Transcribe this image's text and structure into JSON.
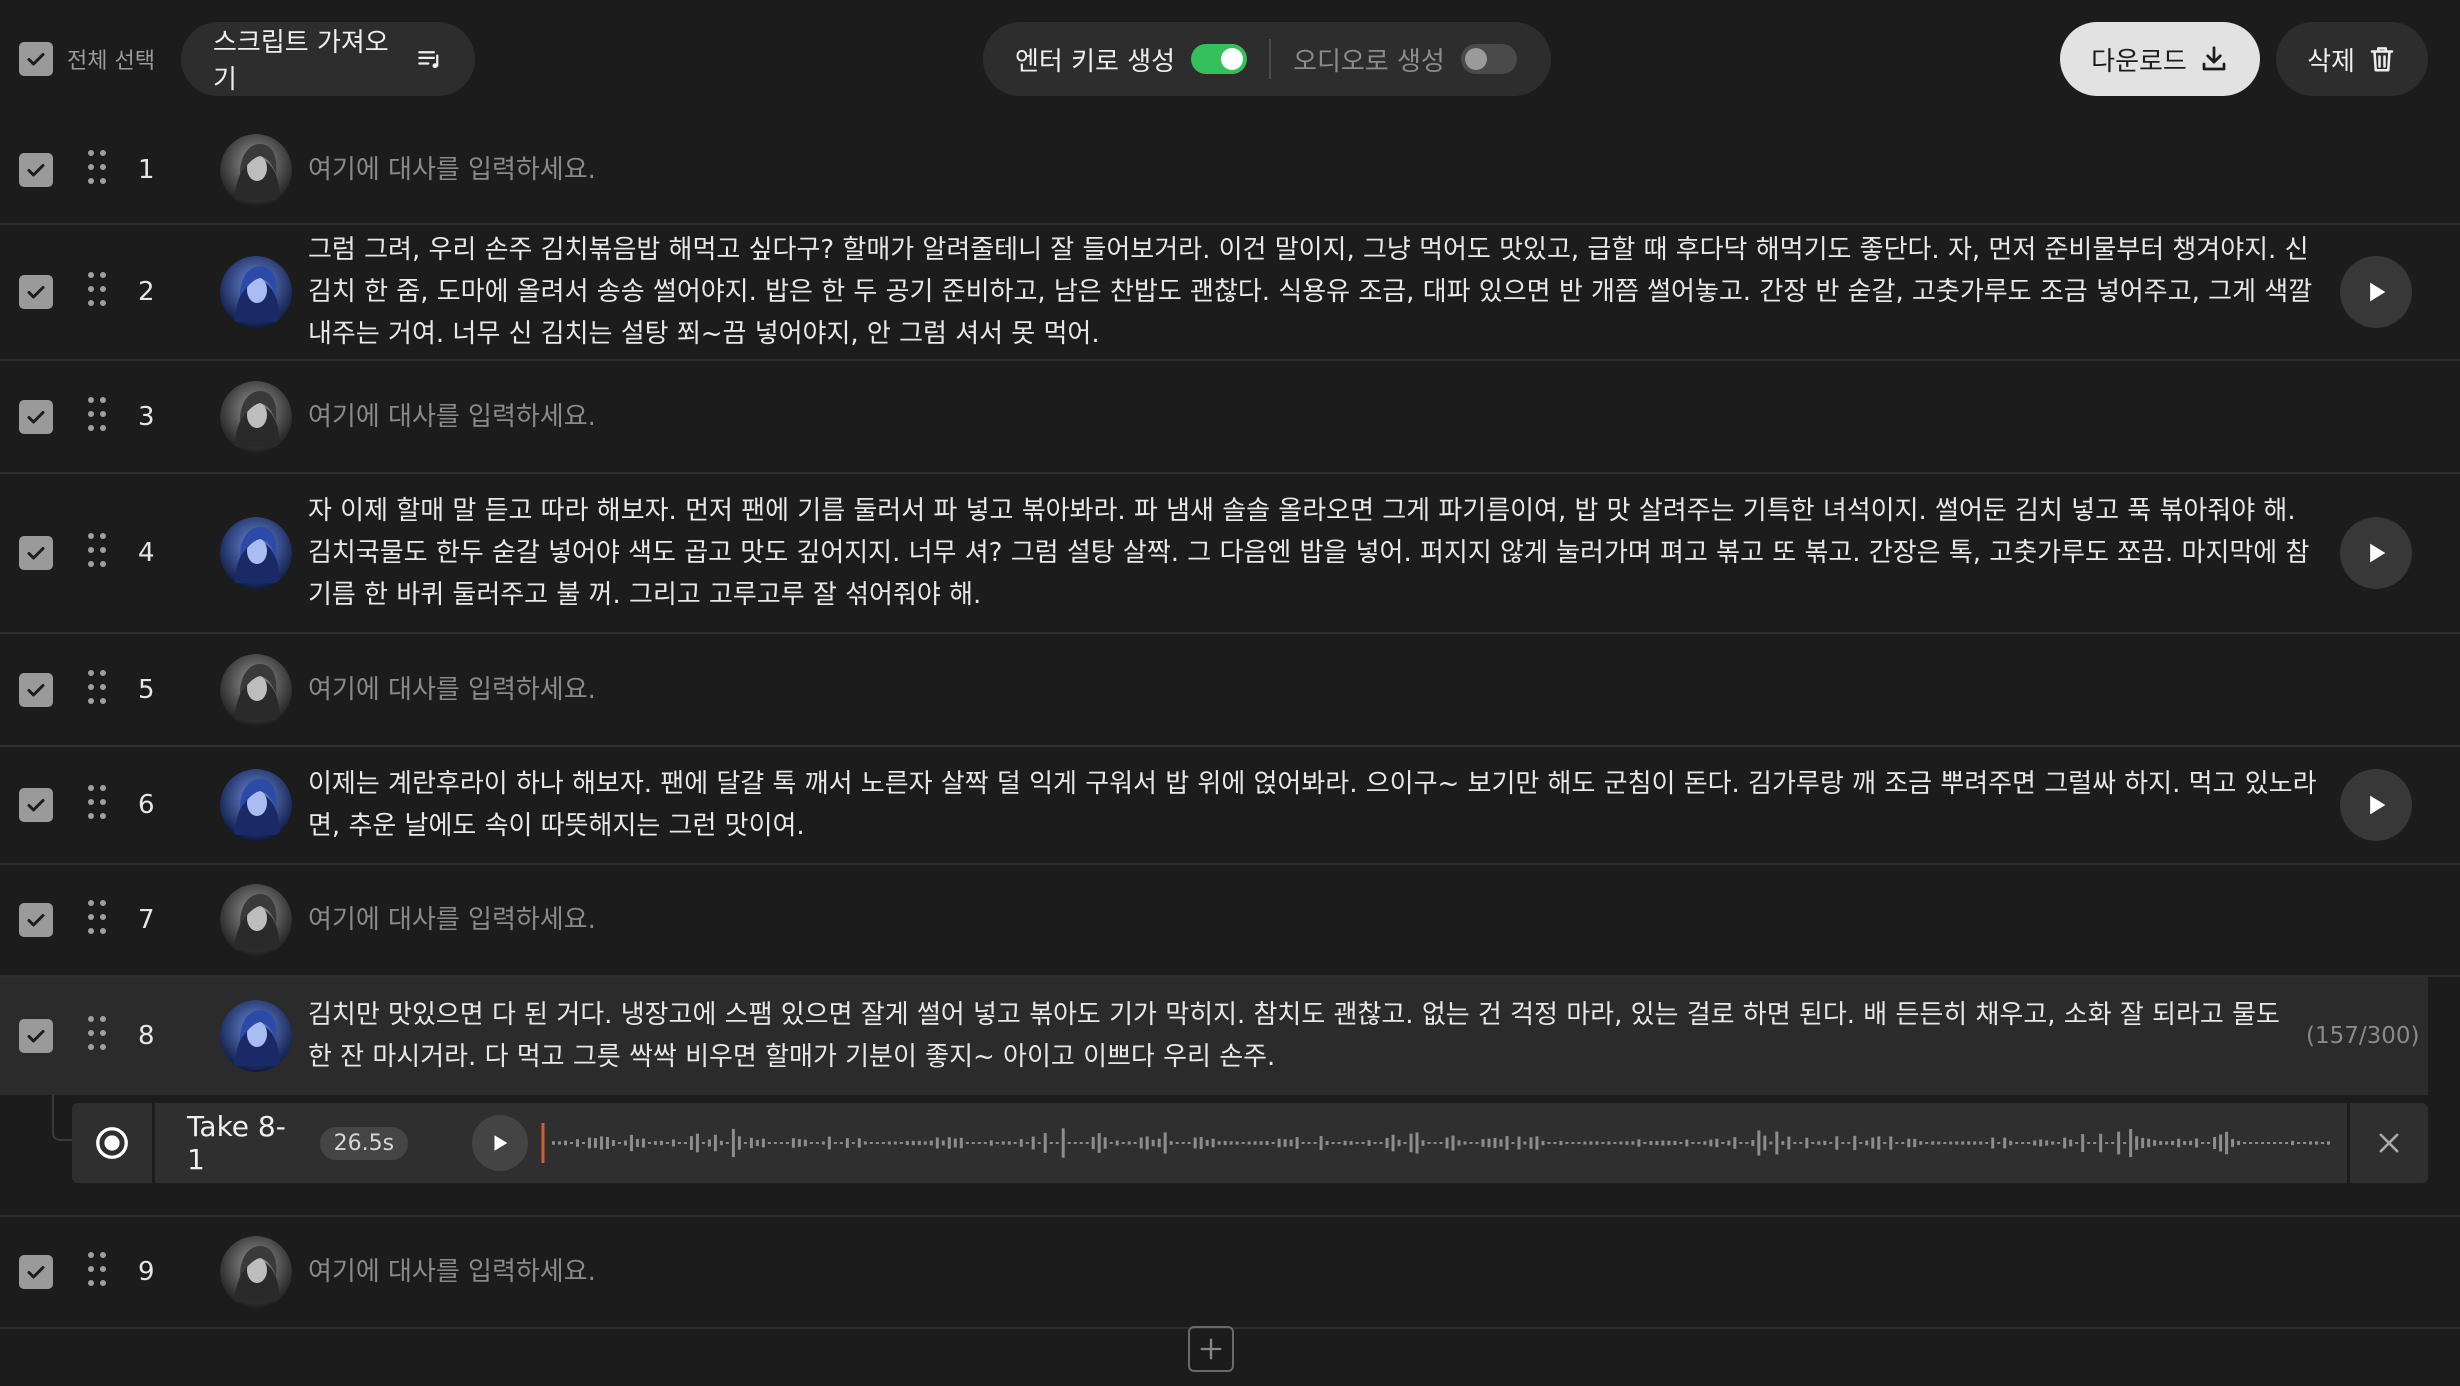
{
  "toolbar": {
    "select_all_label": "전체 선택",
    "import_label": "스크립트 가져오기",
    "enter_gen_label": "엔터 키로 생성",
    "enter_gen_on": true,
    "audio_gen_label": "오디오로 생성",
    "audio_gen_on": false,
    "download_label": "다운로드",
    "delete_label": "삭제"
  },
  "placeholder": "여기에 대사를 입력하세요.",
  "rows": [
    {
      "num": "1",
      "avatar": "dark",
      "text": ""
    },
    {
      "num": "2",
      "avatar": "blue",
      "text": "그럼 그려, 우리 손주 김치볶음밥 해먹고 싶다구? 할매가 알려줄테니 잘 들어보거라. 이건 말이지, 그냥 먹어도 맛있고, 급할 때 후다닥 해먹기도 좋단다. 자, 먼저 준비물부터 챙겨야지. 신김치 한 줌, 도마에 올려서 송송 썰어야지. 밥은 한 두 공기 준비하고, 남은 찬밥도 괜찮다. 식용유 조금, 대파 있으면 반 개쯤 썰어놓고. 간장 반 숟갈, 고춧가루도 조금 넣어주고, 그게 색깔 내주는 거여. 너무 신 김치는 설탕 쬐~끔 넣어야지, 안 그럼 셔서 못 먹어."
    },
    {
      "num": "3",
      "avatar": "dark",
      "text": ""
    },
    {
      "num": "4",
      "avatar": "blue",
      "text": "자 이제 할매 말 듣고 따라 해보자. 먼저 팬에 기름 둘러서 파 넣고 볶아봐라. 파 냄새 솔솔 올라오면 그게 파기름이여, 밥 맛 살려주는 기특한 녀석이지. 썰어둔 김치 넣고 푹 볶아줘야 해. 김치국물도 한두 숟갈 넣어야 색도 곱고 맛도 깊어지지. 너무 셔? 그럼 설탕 살짝. 그 다음엔 밥을 넣어. 퍼지지 않게 눌러가며 펴고 볶고 또 볶고. 간장은 톡, 고춧가루도 쪼끔. 마지막에 참기름 한 바퀴 둘러주고 불 꺼. 그리고 고루고루 잘 섞어줘야 해."
    },
    {
      "num": "5",
      "avatar": "dark",
      "text": ""
    },
    {
      "num": "6",
      "avatar": "blue",
      "text": "이제는 계란후라이 하나 해보자. 팬에 달걀 톡 깨서 노른자 살짝 덜 익게 구워서 밥 위에 얹어봐라. 으이구~ 보기만 해도 군침이 돈다. 김가루랑 깨 조금 뿌려주면 그럴싸 하지. 먹고 있노라면, 추운 날에도 속이 따뜻해지는 그런 맛이여."
    },
    {
      "num": "7",
      "avatar": "dark",
      "text": ""
    },
    {
      "num": "8",
      "avatar": "blue",
      "text": "김치만 맛있으면 다 된 거다. 냉장고에 스팸 있으면 잘게 썰어 넣고 볶아도 기가 막히지. 참치도 괜찮고. 없는 건 걱정 마라, 있는 걸로 하면 된다. 배 든든히 채우고, 소화 잘 되라고 물도 한 잔 마시거라. 다 먹고 그릇 싹싹 비우면 할매가 기분이 좋지~ 아이고 이쁘다 우리 손주.",
      "char_count": "(157/300)"
    },
    {
      "num": "9",
      "avatar": "dark",
      "text": ""
    }
  ],
  "take": {
    "title": "Take 8-1",
    "duration": "26.5s"
  }
}
